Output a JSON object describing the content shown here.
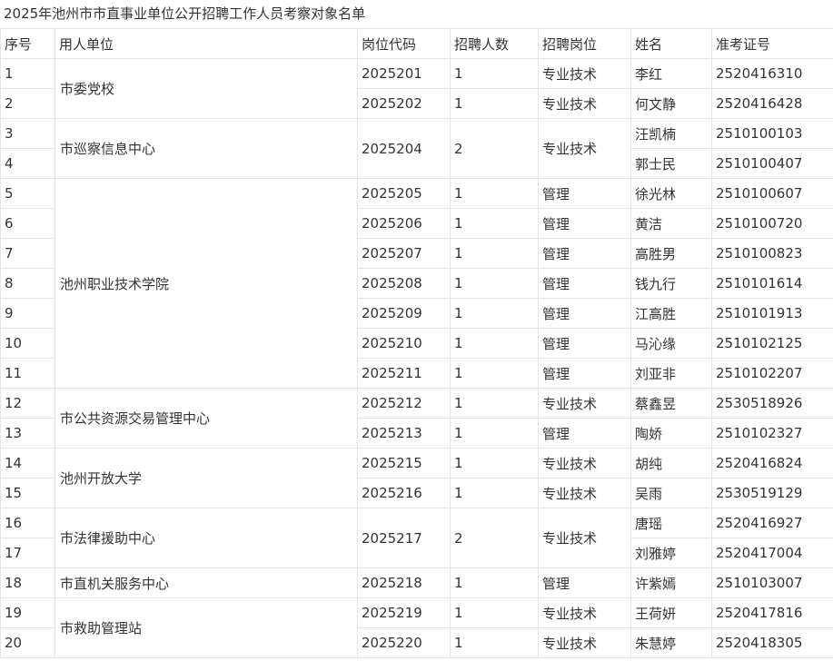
{
  "title": "2025年池州市市直事业单位公开招聘工作人员考察对象名单",
  "headers": [
    "序号",
    "用人单位",
    "岗位代码",
    "招聘人数",
    "招聘岗位",
    "姓名",
    "准考证号"
  ],
  "rows": [
    {
      "no": "1",
      "unit": "市委党校",
      "unit_span": 2,
      "code": "2025201",
      "count": "1",
      "count_span": 1,
      "post": "专业技术",
      "name": "李红",
      "exam": "2520416310"
    },
    {
      "no": "2",
      "code": "2025202",
      "count": "1",
      "count_span": 1,
      "post": "专业技术",
      "name": "何文静",
      "exam": "2520416428"
    },
    {
      "no": "3",
      "unit": "市巡察信息中心",
      "unit_span": 2,
      "code": "2025204",
      "count": "2",
      "count_span": 2,
      "post": "专业技术",
      "name": "汪凯楠",
      "exam": "2510100103"
    },
    {
      "no": "4",
      "name": "郭士民",
      "exam": "2510100407"
    },
    {
      "no": "5",
      "unit": "池州职业技术学院",
      "unit_span": 7,
      "code": "2025205",
      "count": "1",
      "count_span": 1,
      "post": "管理",
      "name": "徐光林",
      "exam": "2510100607"
    },
    {
      "no": "6",
      "code": "2025206",
      "count": "1",
      "count_span": 1,
      "post": "管理",
      "name": "黄洁",
      "exam": "2510100720"
    },
    {
      "no": "7",
      "code": "2025207",
      "count": "1",
      "count_span": 1,
      "post": "管理",
      "name": "高胜男",
      "exam": "2510100823"
    },
    {
      "no": "8",
      "code": "2025208",
      "count": "1",
      "count_span": 1,
      "post": "管理",
      "name": "钱九行",
      "exam": "2510101614"
    },
    {
      "no": "9",
      "code": "2025209",
      "count": "1",
      "count_span": 1,
      "post": "管理",
      "name": "江高胜",
      "exam": "2510101913"
    },
    {
      "no": "10",
      "code": "2025210",
      "count": "1",
      "count_span": 1,
      "post": "管理",
      "name": "马沁缘",
      "exam": "2510102125"
    },
    {
      "no": "11",
      "code": "2025211",
      "count": "1",
      "count_span": 1,
      "post": "管理",
      "name": "刘亚非",
      "exam": "2510102207"
    },
    {
      "no": "12",
      "unit": "市公共资源交易管理中心",
      "unit_span": 2,
      "code": "2025212",
      "count": "1",
      "count_span": 1,
      "post": "专业技术",
      "name": "蔡鑫昱",
      "exam": "2530518926"
    },
    {
      "no": "13",
      "code": "2025213",
      "count": "1",
      "count_span": 1,
      "post": "管理",
      "name": "陶娇",
      "exam": "2510102327"
    },
    {
      "no": "14",
      "unit": "池州开放大学",
      "unit_span": 2,
      "code": "2025215",
      "count": "1",
      "count_span": 1,
      "post": "专业技术",
      "name": "胡纯",
      "exam": "2520416824"
    },
    {
      "no": "15",
      "code": "2025216",
      "count": "1",
      "count_span": 1,
      "post": "专业技术",
      "name": "吴雨",
      "exam": "2530519129"
    },
    {
      "no": "16",
      "unit": "市法律援助中心",
      "unit_span": 2,
      "code": "2025217",
      "count": "2",
      "count_span": 2,
      "post": "专业技术",
      "name": "唐瑶",
      "exam": "2520416927"
    },
    {
      "no": "17",
      "name": "刘雅婷",
      "exam": "2520417004"
    },
    {
      "no": "18",
      "unit": "市直机关服务中心",
      "unit_span": 1,
      "code": "2025218",
      "count": "1",
      "count_span": 1,
      "post": "管理",
      "name": "许紫嫣",
      "exam": "2510103007"
    },
    {
      "no": "19",
      "unit": "市救助管理站",
      "unit_span": 2,
      "code": "2025219",
      "count": "1",
      "count_span": 1,
      "post": "专业技术",
      "name": "王荷妍",
      "exam": "2520417816"
    },
    {
      "no": "20",
      "code": "2025220",
      "count": "1",
      "count_span": 1,
      "post": "专业技术",
      "name": "朱慧婷",
      "exam": "2520418305"
    }
  ]
}
